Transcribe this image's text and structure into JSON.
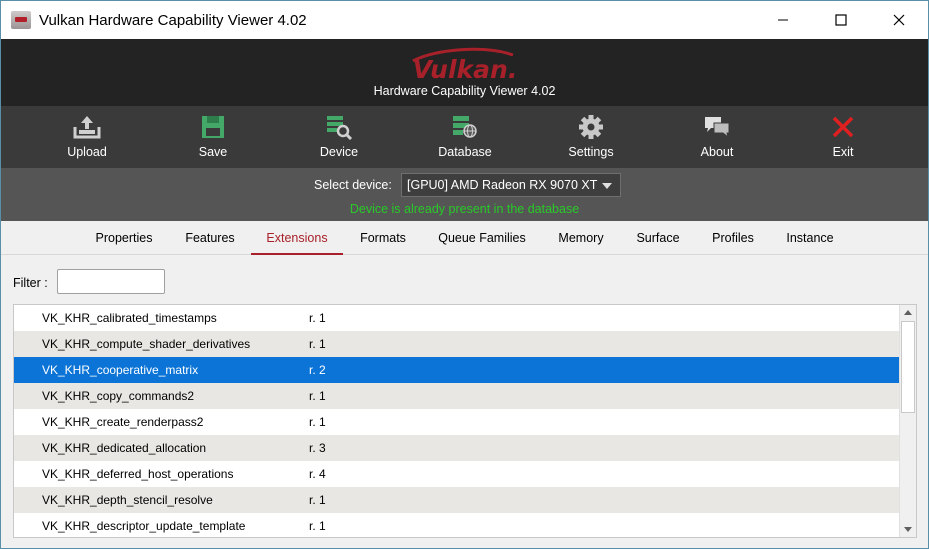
{
  "window": {
    "title": "Vulkan Hardware Capability Viewer 4.02"
  },
  "header": {
    "logo": "Vulkan.",
    "subtitle": "Hardware Capability Viewer 4.02"
  },
  "toolbar": {
    "upload": "Upload",
    "save": "Save",
    "device": "Device",
    "database": "Database",
    "settings": "Settings",
    "about": "About",
    "exit": "Exit"
  },
  "device_bar": {
    "select_label": "Select device:",
    "selected_device": "[GPU0] AMD Radeon RX 9070 XT",
    "status": "Device is already present in the database"
  },
  "tabs": [
    "Properties",
    "Features",
    "Extensions",
    "Formats",
    "Queue Families",
    "Memory",
    "Surface",
    "Profiles",
    "Instance"
  ],
  "active_tab": "Extensions",
  "filter": {
    "label": "Filter :",
    "value": ""
  },
  "extensions": [
    {
      "name": "VK_KHR_calibrated_timestamps",
      "revision": "r. 1"
    },
    {
      "name": "VK_KHR_compute_shader_derivatives",
      "revision": "r. 1"
    },
    {
      "name": "VK_KHR_cooperative_matrix",
      "revision": "r. 2"
    },
    {
      "name": "VK_KHR_copy_commands2",
      "revision": "r. 1"
    },
    {
      "name": "VK_KHR_create_renderpass2",
      "revision": "r. 1"
    },
    {
      "name": "VK_KHR_dedicated_allocation",
      "revision": "r. 3"
    },
    {
      "name": "VK_KHR_deferred_host_operations",
      "revision": "r. 4"
    },
    {
      "name": "VK_KHR_depth_stencil_resolve",
      "revision": "r. 1"
    },
    {
      "name": "VK_KHR_descriptor_update_template",
      "revision": "r. 1"
    }
  ],
  "selected_row": 2,
  "colors": {
    "accent_red": "#a8212a",
    "selection_blue": "#0b74d6",
    "status_green": "#29c929",
    "icon_green": "#44a868"
  },
  "icons": {
    "upload": "upload-icon",
    "save": "floppy-disk-icon",
    "device": "device-search-icon",
    "database": "database-globe-icon",
    "settings": "gear-icon",
    "about": "chat-bubbles-icon",
    "exit": "red-x-icon"
  }
}
